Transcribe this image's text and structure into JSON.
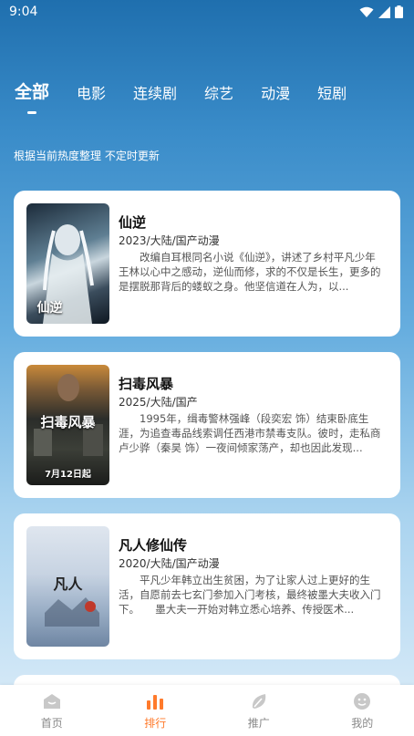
{
  "status_bar": {
    "time": "9:04"
  },
  "tabs": [
    {
      "label": "全部",
      "active": true
    },
    {
      "label": "电影",
      "active": false
    },
    {
      "label": "连续剧",
      "active": false
    },
    {
      "label": "综艺",
      "active": false
    },
    {
      "label": "动漫",
      "active": false
    },
    {
      "label": "短剧",
      "active": false
    }
  ],
  "subtitle": "根据当前热度整理 不定时更新",
  "items": [
    {
      "title": "仙逆",
      "meta": "2023/大陆/国产动漫",
      "desc": "改编自耳根同名小说《仙逆》，讲述了乡村平凡少年王林以心中之感动，逆仙而修，求的不仅是长生，更多的是摆脱那背后的蝼蚁之身。他坚信道在人为，以...",
      "poster_text": "仙逆"
    },
    {
      "title": "扫毒风暴",
      "meta": "2025/大陆/国产",
      "desc": "1995年，缉毒警林强峰（段奕宏 饰）结束卧底生涯，为追查毒品线索调任西港市禁毒支队。彼时，走私商卢少骅（秦昊 饰）一夜间倾家荡产，却也因此发现...",
      "poster_text": "扫毒风暴",
      "poster_badge": "7月12日起"
    },
    {
      "title": "凡人修仙传",
      "meta": "2020/大陆/国产动漫",
      "desc": "平凡少年韩立出生贫困，为了让家人过上更好的生活，自愿前去七玄门参加入门考核，最终被墨大夫收入门下。　　墨大夫一开始对韩立悉心培养、传授医术...",
      "poster_text": "凡人"
    }
  ],
  "bottom_nav": [
    {
      "label": "首页",
      "icon": "home-icon",
      "active": false
    },
    {
      "label": "排行",
      "icon": "ranking-icon",
      "active": true
    },
    {
      "label": "推广",
      "icon": "promote-icon",
      "active": false
    },
    {
      "label": "我的",
      "icon": "profile-icon",
      "active": false
    }
  ],
  "colors": {
    "accent": "#ff7a2b",
    "nav_inactive": "#c8c8c8"
  }
}
